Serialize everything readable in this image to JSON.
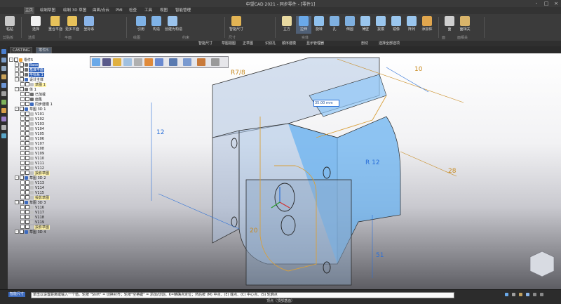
{
  "window": {
    "title": "中望CAD 2021 - 同步零件 - [零件1]",
    "buttons": [
      "-",
      "□",
      "×"
    ]
  },
  "menu": [
    "主页",
    "绘制草图",
    "绘制 3D 草图",
    "曲面/点云",
    "PMI",
    "检查",
    "工具",
    "视图",
    "智能管理"
  ],
  "ribbon": {
    "buttons": [
      {
        "label": "粘贴",
        "icon": "paste-icon",
        "color": "#c9c9c9"
      },
      {
        "label": "选择",
        "icon": "select-arrow-icon",
        "color": "#f0f0f0"
      },
      {
        "label": "重合平面",
        "icon": "coincident-plane-icon",
        "color": "#e8c25a"
      },
      {
        "label": "更多平面",
        "icon": "more-planes-icon",
        "color": "#e8c25a"
      },
      {
        "label": "坐标系",
        "icon": "coordinate-system-icon",
        "color": "#8ab4e8"
      },
      {
        "label": "引用",
        "icon": "reference-icon",
        "color": "#7fb2e6"
      },
      {
        "label": "构造",
        "icon": "construct-icon",
        "color": "#7fb2e6"
      },
      {
        "label": "创建为构造",
        "icon": "create-as-construct-icon",
        "color": "#9bc3ec"
      },
      {
        "label": "智能尺寸",
        "icon": "smart-dimension-icon",
        "color": "#e2b454"
      },
      {
        "label": "立方",
        "icon": "cube-icon",
        "color": "#e8d9a0"
      },
      {
        "label": "拉伸",
        "icon": "extrude-icon",
        "color": "#6aa9e9"
      },
      {
        "label": "旋转",
        "icon": "revolve-icon",
        "color": "#8fc1ee"
      },
      {
        "label": "孔",
        "icon": "hole-icon",
        "color": "#7fb0e0"
      },
      {
        "label": "倒圆",
        "icon": "round-icon",
        "color": "#7fb0e0"
      },
      {
        "label": "薄壁",
        "icon": "thin-wall-icon",
        "color": "#9ac6ee"
      },
      {
        "label": "拔模",
        "icon": "draft-icon",
        "color": "#9ac6ee"
      },
      {
        "label": "镜像",
        "icon": "mirror-icon",
        "color": "#9ac6ee"
      },
      {
        "label": "阵列",
        "icon": "pattern-icon",
        "color": "#9ac6ee"
      },
      {
        "label": "添加体",
        "icon": "add-body-icon",
        "color": "#e0a64e"
      },
      {
        "label": "面",
        "icon": "face-icon",
        "color": "#cfcfcf"
      },
      {
        "label": "面相关",
        "icon": "face-relate-icon",
        "color": "#d9b46a"
      }
    ],
    "groups": [
      "剪贴板",
      "选择",
      "平面",
      "绘图",
      "约束",
      "尺寸",
      "实体",
      "面",
      "面相关"
    ],
    "selected_label": "拉伸"
  },
  "command_bar": [
    "智能尺寸",
    "草图视图",
    "正草图",
    "识别孔",
    "顺序建模",
    "显示管理器",
    "剖切",
    "选择全部选项"
  ],
  "doc_tabs": [
    "CASTING",
    "零件5"
  ],
  "active_tab": "零件5",
  "tree": [
    {
      "level": 0,
      "label": "零件5",
      "style": "",
      "icon": "#f0a030"
    },
    {
      "level": 1,
      "label": "Base",
      "style": "blue",
      "icon": "#6b6b6b"
    },
    {
      "level": 1,
      "label": "基准平面",
      "style": "blue",
      "icon": "#6b6b6b"
    },
    {
      "level": 1,
      "label": "坐标系 1",
      "style": "blue",
      "icon": "#6b6b6b"
    },
    {
      "level": 1,
      "label": "设计主体",
      "style": "",
      "icon": "#3d6bbf"
    },
    {
      "level": 2,
      "label": "草图 1",
      "style": "ylw",
      "icon": "#c0c0c0"
    },
    {
      "level": 1,
      "label": "体 1",
      "style": "",
      "icon": "#6b6b6b"
    },
    {
      "level": 2,
      "label": "已加载",
      "style": "",
      "icon": "#6b6b6b"
    },
    {
      "level": 2,
      "label": "面集",
      "style": "",
      "icon": "#6b6b6b"
    },
    {
      "level": 2,
      "label": "同步建模 1",
      "style": "",
      "icon": "#3d6bbf"
    },
    {
      "level": 1,
      "label": "草图 3D 1",
      "style": "",
      "icon": "#3d6bbf"
    },
    {
      "level": 2,
      "label": "V101",
      "style": "",
      "icon": "#c0c0c0"
    },
    {
      "level": 2,
      "label": "V102",
      "style": "",
      "icon": "#c0c0c0"
    },
    {
      "level": 2,
      "label": "V103",
      "style": "",
      "icon": "#c0c0c0"
    },
    {
      "level": 2,
      "label": "V104",
      "style": "",
      "icon": "#c0c0c0"
    },
    {
      "level": 2,
      "label": "V105",
      "style": "",
      "icon": "#c0c0c0"
    },
    {
      "level": 2,
      "label": "V106",
      "style": "",
      "icon": "#c0c0c0"
    },
    {
      "level": 2,
      "label": "V107",
      "style": "",
      "icon": "#c0c0c0"
    },
    {
      "level": 2,
      "label": "V108",
      "style": "",
      "icon": "#c0c0c0"
    },
    {
      "level": 2,
      "label": "V109",
      "style": "",
      "icon": "#c0c0c0"
    },
    {
      "level": 2,
      "label": "V110",
      "style": "",
      "icon": "#c0c0c0"
    },
    {
      "level": 2,
      "label": "V111",
      "style": "",
      "icon": "#c0c0c0"
    },
    {
      "level": 2,
      "label": "V112",
      "style": "",
      "icon": "#c0c0c0"
    },
    {
      "level": 2,
      "label": "投影草图",
      "style": "ylw",
      "icon": "#c0c0c0"
    },
    {
      "level": 1,
      "label": "草图 3D 2",
      "style": "",
      "icon": "#3d6bbf"
    },
    {
      "level": 2,
      "label": "V113",
      "style": "",
      "icon": "#c0c0c0"
    },
    {
      "level": 2,
      "label": "V114",
      "style": "",
      "icon": "#c0c0c0"
    },
    {
      "level": 2,
      "label": "V115",
      "style": "",
      "icon": "#c0c0c0"
    },
    {
      "level": 2,
      "label": "投影草图",
      "style": "ylw",
      "icon": "#c0c0c0"
    },
    {
      "level": 1,
      "label": "草图 3D 3",
      "style": "",
      "icon": "#3d6bbf"
    },
    {
      "level": 2,
      "label": "V116",
      "style": "",
      "icon": "#c0c0c0"
    },
    {
      "level": 2,
      "label": "V117",
      "style": "",
      "icon": "#c0c0c0"
    },
    {
      "level": 2,
      "label": "V118",
      "style": "",
      "icon": "#c0c0c0"
    },
    {
      "level": 2,
      "label": "V119",
      "style": "",
      "icon": "#c0c0c0"
    },
    {
      "level": 2,
      "label": "投影草图",
      "style": "ylw",
      "icon": "#c0c0c0"
    },
    {
      "level": 1,
      "label": "草图 3D 4",
      "style": "",
      "icon": "#3d6bbf"
    }
  ],
  "dimensions": {
    "d1": "R7/8",
    "d2": "10",
    "d3": "R 12",
    "d4": "20",
    "d5": "51",
    "d6": "28",
    "d7": "12",
    "field": "35.00 mm"
  },
  "status": {
    "command": "智能尺寸",
    "hint": "单击以设置距离或输入一个值。轮按 \"Shift\" = 切换对齐；轮按\"空格键\" = 添加/切割。K=精确点定位；然后按 (M) 中点、(E) 端点、(C) 中心点、(S) 轮廓点",
    "view": "顶点（顶部基面）"
  },
  "colors": {
    "accent": "#3d6bbf",
    "dim": "#c88a1f",
    "part": "#a9c4e6",
    "part_highlight": "#6bb3f0"
  }
}
